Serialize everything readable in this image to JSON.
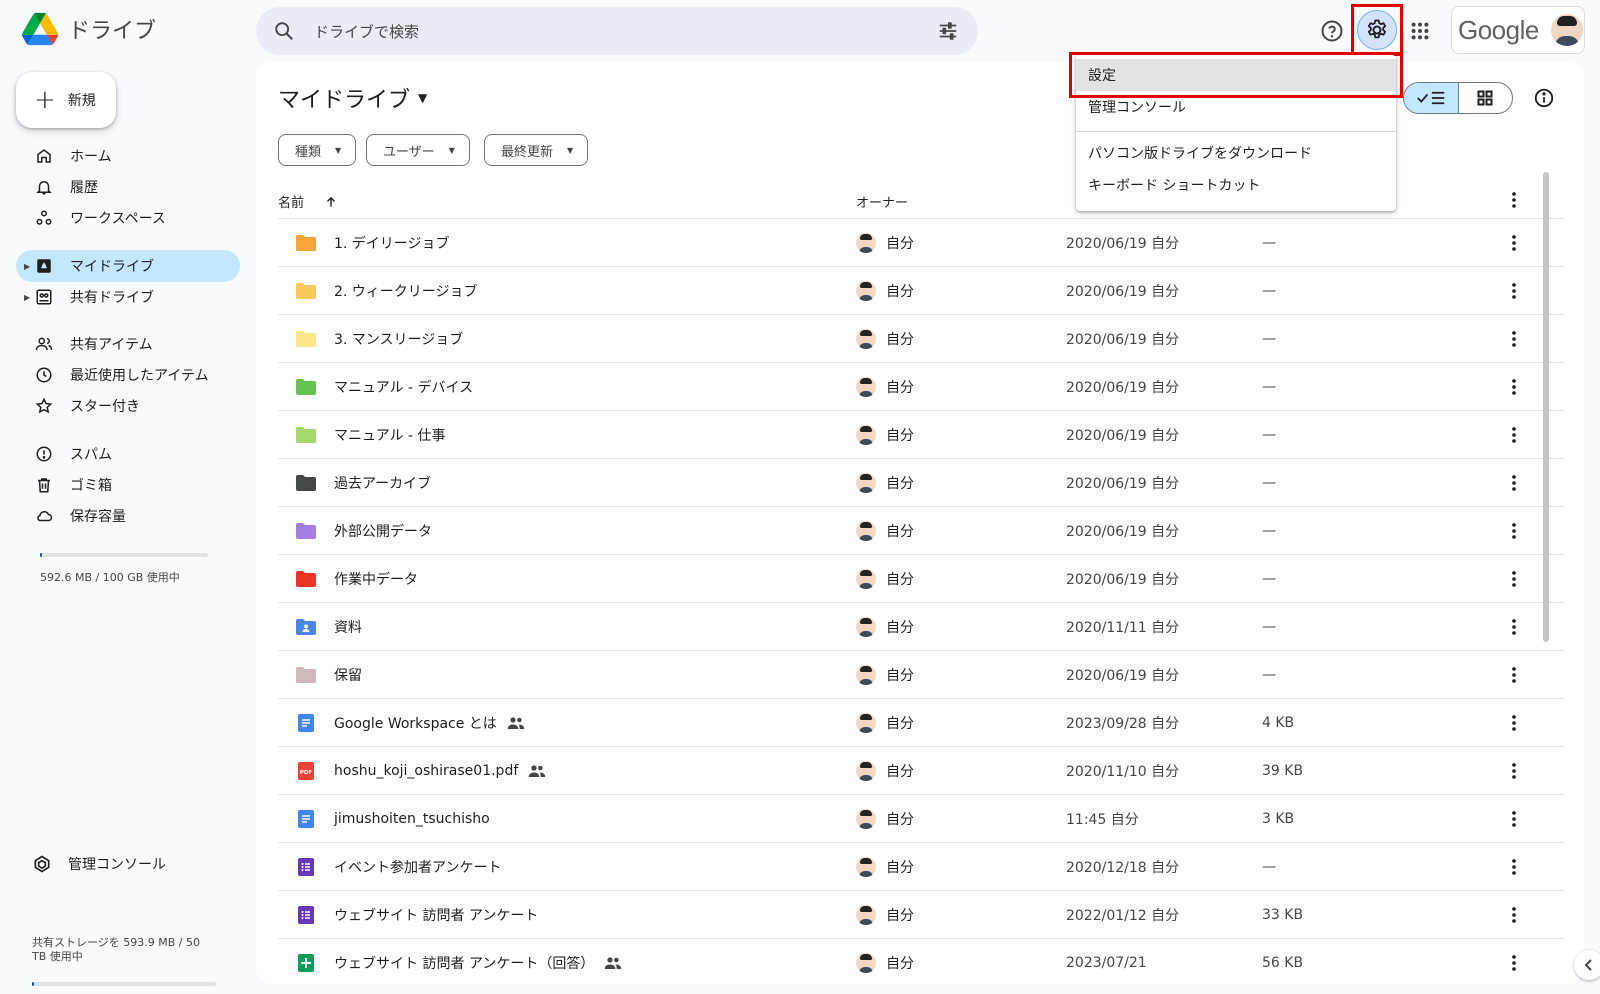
{
  "app": {
    "name": "ドライブ"
  },
  "search": {
    "placeholder": "ドライブで検索"
  },
  "header": {
    "google_label": "Google"
  },
  "sidebar": {
    "new_label": "新規",
    "items": [
      {
        "label": "ホーム",
        "icon": "home-icon"
      },
      {
        "label": "履歴",
        "icon": "bell-icon"
      },
      {
        "label": "ワークスペース",
        "icon": "workspace-icon"
      },
      {
        "label": "マイドライブ",
        "icon": "my-drive-icon",
        "active": true
      },
      {
        "label": "共有ドライブ",
        "icon": "shared-drive-icon"
      },
      {
        "label": "共有アイテム",
        "icon": "people-icon"
      },
      {
        "label": "最近使用したアイテム",
        "icon": "clock-icon"
      },
      {
        "label": "スター付き",
        "icon": "star-icon"
      },
      {
        "label": "スパム",
        "icon": "spam-icon"
      },
      {
        "label": "ゴミ箱",
        "icon": "trash-icon"
      },
      {
        "label": "保存容量",
        "icon": "cloud-icon"
      }
    ],
    "storage_text": "592.6 MB / 100 GB 使用中",
    "storage_fraction": 0.006,
    "admin_label": "管理コンソール",
    "shared_storage_line1": "共有ストレージを 593.9 MB / 50",
    "shared_storage_line2": "TB 使用中"
  },
  "main": {
    "title": "マイドライブ",
    "filters": [
      "種類",
      "ユーザー",
      "最終更新"
    ],
    "columns": {
      "name": "名前",
      "owner": "オーナー"
    },
    "rows": [
      {
        "name": "1. デイリージョブ",
        "type": "folder",
        "color": "#f6a53a",
        "owner": "自分",
        "date": "2020/06/19 自分",
        "size": "—"
      },
      {
        "name": "2. ウィークリージョブ",
        "type": "folder",
        "color": "#fbc95b",
        "owner": "自分",
        "date": "2020/06/19 自分",
        "size": "—"
      },
      {
        "name": "3. マンスリージョブ",
        "type": "folder",
        "color": "#fde58a",
        "owner": "自分",
        "date": "2020/06/19 自分",
        "size": "—"
      },
      {
        "name": "マニュアル - デバイス",
        "type": "folder",
        "color": "#65c451",
        "owner": "自分",
        "date": "2020/06/19 自分",
        "size": "—"
      },
      {
        "name": "マニュアル - 仕事",
        "type": "folder",
        "color": "#a7d76a",
        "owner": "自分",
        "date": "2020/06/19 自分",
        "size": "—"
      },
      {
        "name": "過去アーカイブ",
        "type": "folder",
        "color": "#444746",
        "owner": "自分",
        "date": "2020/06/19 自分",
        "size": "—"
      },
      {
        "name": "外部公開データ",
        "type": "folder",
        "color": "#a77ee6",
        "owner": "自分",
        "date": "2020/06/19 自分",
        "size": "—"
      },
      {
        "name": "作業中データ",
        "type": "folder",
        "color": "#ea3323",
        "owner": "自分",
        "date": "2020/06/19 自分",
        "size": "—"
      },
      {
        "name": "資料",
        "type": "shared-folder",
        "color": "#4a86e8",
        "owner": "自分",
        "date": "2020/11/11 自分",
        "size": "—"
      },
      {
        "name": "保留",
        "type": "folder",
        "color": "#cfb7bb",
        "owner": "自分",
        "date": "2020/06/19 自分",
        "size": "—"
      },
      {
        "name": "Google Workspace とは",
        "type": "doc",
        "color": "#4285f4",
        "owner": "自分",
        "date": "2023/09/28 自分",
        "size": "4 KB",
        "shared": true
      },
      {
        "name": "hoshu_koji_oshirase01.pdf",
        "type": "pdf",
        "color": "#ea4335",
        "owner": "自分",
        "date": "2020/11/10 自分",
        "size": "39 KB",
        "shared": true
      },
      {
        "name": "jimushoiten_tsuchisho",
        "type": "doc",
        "color": "#4285f4",
        "owner": "自分",
        "date": "11:45 自分",
        "size": "3 KB"
      },
      {
        "name": "イベント参加者アンケート",
        "type": "form",
        "color": "#673ab7",
        "owner": "自分",
        "date": "2020/12/18 自分",
        "size": "—"
      },
      {
        "name": "ウェブサイト 訪問者 アンケート",
        "type": "form",
        "color": "#673ab7",
        "owner": "自分",
        "date": "2022/01/12 自分",
        "size": "33 KB"
      },
      {
        "name": "ウェブサイト 訪問者 アンケート（回答）",
        "type": "sheet",
        "color": "#0f9d58",
        "owner": "自分",
        "date": "2023/07/21",
        "size": "56 KB",
        "shared": true
      }
    ]
  },
  "settings_menu": {
    "items": [
      "設定",
      "管理コンソール",
      "パソコン版ドライブをダウンロード",
      "キーボード ショートカット"
    ]
  }
}
